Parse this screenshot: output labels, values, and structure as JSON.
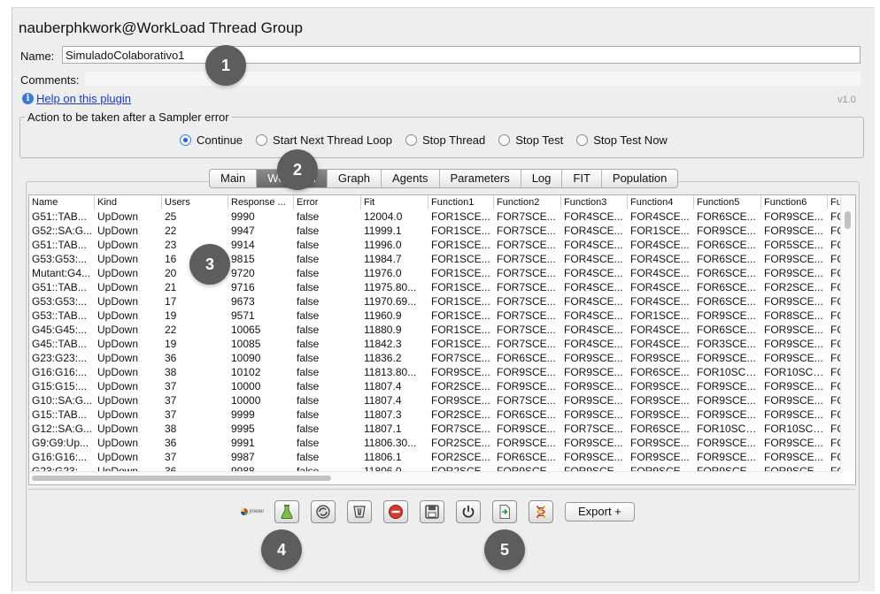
{
  "window": {
    "title": "nauberphkwork@WorkLoad Thread Group"
  },
  "form": {
    "name_label": "Name:",
    "name_value": "SimuladoColaborativo1",
    "comments_label": "Comments:",
    "help_link": "Help on this plugin",
    "version": "v1.0"
  },
  "sampler_error": {
    "legend": "Action to be taken after a Sampler error",
    "options": [
      "Continue",
      "Start Next Thread Loop",
      "Stop Thread",
      "Stop Test",
      "Stop Test Now"
    ],
    "selected": "Continue"
  },
  "tabs": [
    "Main",
    "Workload",
    "Graph",
    "Agents",
    "Parameters",
    "Log",
    "FIT",
    "Population"
  ],
  "active_tab": "Workload",
  "table": {
    "columns": [
      "Name",
      "Kind",
      "Users",
      "Response ...",
      "Error",
      "Fit",
      "Function1",
      "Function2",
      "Function3",
      "Function4",
      "Function5",
      "Function6",
      "Fu"
    ],
    "rows": [
      [
        "G51::TAB...",
        "UpDown",
        "25",
        "9990",
        "false",
        "12004.0",
        "FOR1SCE...",
        "FOR7SCE...",
        "FOR4SCE...",
        "FOR4SCE...",
        "FOR6SCE...",
        "FOR9SCE...",
        "FOI"
      ],
      [
        "G52::SA:G...",
        "UpDown",
        "22",
        "9947",
        "false",
        "11999.1",
        "FOR1SCE...",
        "FOR7SCE...",
        "FOR4SCE...",
        "FOR1SCE...",
        "FOR9SCE...",
        "FOR9SCE...",
        "FOI"
      ],
      [
        "G51::TAB...",
        "UpDown",
        "23",
        "9914",
        "false",
        "11996.0",
        "FOR1SCE...",
        "FOR7SCE...",
        "FOR4SCE...",
        "FOR4SCE...",
        "FOR6SCE...",
        "FOR5SCE...",
        "FOI"
      ],
      [
        "G53:G53:...",
        "UpDown",
        "16",
        "9815",
        "false",
        "11984.7",
        "FOR1SCE...",
        "FOR7SCE...",
        "FOR4SCE...",
        "FOR4SCE...",
        "FOR6SCE...",
        "FOR9SCE...",
        "FOI"
      ],
      [
        "Mutant:G4...",
        "UpDown",
        "20",
        "9720",
        "false",
        "11976.0",
        "FOR1SCE...",
        "FOR7SCE...",
        "FOR4SCE...",
        "FOR4SCE...",
        "FOR6SCE...",
        "FOR9SCE...",
        "FOI"
      ],
      [
        "G51::TAB...",
        "UpDown",
        "21",
        "9716",
        "false",
        "11975.80...",
        "FOR1SCE...",
        "FOR7SCE...",
        "FOR4SCE...",
        "FOR4SCE...",
        "FOR6SCE...",
        "FOR2SCE...",
        "FOI"
      ],
      [
        "G53:G53:...",
        "UpDown",
        "17",
        "9673",
        "false",
        "11970.69...",
        "FOR1SCE...",
        "FOR7SCE...",
        "FOR4SCE...",
        "FOR4SCE...",
        "FOR6SCE...",
        "FOR9SCE...",
        "FOI"
      ],
      [
        "G53::TAB...",
        "UpDown",
        "19",
        "9571",
        "false",
        "11960.9",
        "FOR1SCE...",
        "FOR7SCE...",
        "FOR4SCE...",
        "FOR1SCE...",
        "FOR9SCE...",
        "FOR8SCE...",
        "FOI"
      ],
      [
        "G45:G45:...",
        "UpDown",
        "22",
        "10065",
        "false",
        "11880.9",
        "FOR1SCE...",
        "FOR7SCE...",
        "FOR4SCE...",
        "FOR4SCE...",
        "FOR6SCE...",
        "FOR9SCE...",
        "FOI"
      ],
      [
        "G45::TAB...",
        "UpDown",
        "19",
        "10085",
        "false",
        "11842.3",
        "FOR1SCE...",
        "FOR7SCE...",
        "FOR4SCE...",
        "FOR4SCE...",
        "FOR3SCE...",
        "FOR9SCE...",
        "FOI"
      ],
      [
        "G23:G23:...",
        "UpDown",
        "36",
        "10090",
        "false",
        "11836.2",
        "FOR7SCE...",
        "FOR6SCE...",
        "FOR9SCE...",
        "FOR9SCE...",
        "FOR9SCE...",
        "FOR9SCE...",
        "FOI"
      ],
      [
        "G16:G16:...",
        "UpDown",
        "38",
        "10102",
        "false",
        "11813.80...",
        "FOR9SCE...",
        "FOR9SCE...",
        "FOR9SCE...",
        "FOR6SCE...",
        "FOR10SCE...",
        "FOR10SCE...",
        "FOI"
      ],
      [
        "G15:G15:...",
        "UpDown",
        "37",
        "10000",
        "false",
        "11807.4",
        "FOR2SCE...",
        "FOR9SCE...",
        "FOR9SCE...",
        "FOR9SCE...",
        "FOR9SCE...",
        "FOR9SCE...",
        "FOI"
      ],
      [
        "G10::SA:G...",
        "UpDown",
        "37",
        "10000",
        "false",
        "11807.4",
        "FOR9SCE...",
        "FOR7SCE...",
        "FOR9SCE...",
        "FOR9SCE...",
        "FOR9SCE...",
        "FOR9SCE...",
        "FOI"
      ],
      [
        "G15::TAB...",
        "UpDown",
        "37",
        "9999",
        "false",
        "11807.3",
        "FOR2SCE...",
        "FOR6SCE...",
        "FOR9SCE...",
        "FOR9SCE...",
        "FOR9SCE...",
        "FOR9SCE...",
        "FOI"
      ],
      [
        "G12::SA:G...",
        "UpDown",
        "38",
        "9995",
        "false",
        "11807.1",
        "FOR7SCE...",
        "FOR9SCE...",
        "FOR7SCE...",
        "FOR6SCE...",
        "FOR10SCE...",
        "FOR10SCE...",
        "FOI"
      ],
      [
        "G9:G9:Up...",
        "UpDown",
        "36",
        "9991",
        "false",
        "11806.30...",
        "FOR2SCE...",
        "FOR9SCE...",
        "FOR9SCE...",
        "FOR9SCE...",
        "FOR9SCE...",
        "FOR9SCE...",
        "FOI"
      ],
      [
        "G16:G16:...",
        "UpDown",
        "37",
        "9987",
        "false",
        "11806.1",
        "FOR2SCE...",
        "FOR6SCE...",
        "FOR9SCE...",
        "FOR9SCE...",
        "FOR9SCE...",
        "FOR9SCE...",
        "FOI"
      ],
      [
        "G23:G23:...",
        "UpDown",
        "36",
        "9988",
        "false",
        "11806.0",
        "FOR2SCE...",
        "FOR9SCE...",
        "FOR9SCE...",
        "FOR9SCE...",
        "FOR9SCE...",
        "FOR9SCE...",
        "FOI"
      ]
    ]
  },
  "toolbar": {
    "logo_text": "jmeter",
    "buttons": [
      "flask-icon",
      "gear-cycle-icon",
      "clear-bin-icon",
      "stop-icon",
      "save-icon",
      "power-icon",
      "export-file-icon",
      "dna-icon"
    ],
    "export_label": "Export +"
  },
  "callouts": [
    "1",
    "2",
    "3",
    "4",
    "5"
  ],
  "colors": {
    "accent": "#2a63c6",
    "link": "#1a3ccc",
    "callout": "#5d5d5d"
  }
}
